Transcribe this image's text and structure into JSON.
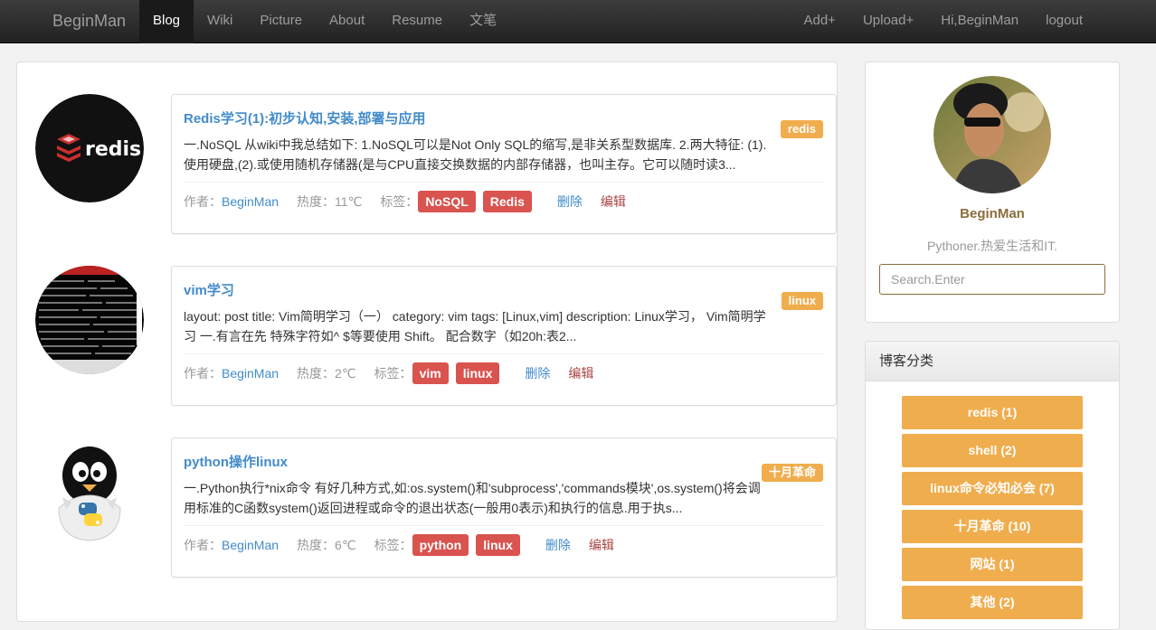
{
  "nav": {
    "brand": "BeginMan",
    "left": [
      "Blog",
      "Wiki",
      "Picture",
      "About",
      "Resume",
      "文笔"
    ],
    "right": [
      "Add+",
      "Upload+",
      "Hi,BeginMan",
      "logout"
    ]
  },
  "posts": [
    {
      "title": "Redis学习(1):初步认知,安装,部署与应用",
      "category": "redis",
      "excerpt": "一.NoSQL 从wiki中我总结如下: 1.NoSQL可以是Not Only SQL的缩写,是非关系型数据库. 2.两大特征: (1).使用硬盘,(2).或使用随机存储器(是与CPU直接交换数据的内部存储器，也叫主存。它可以随时读3...",
      "author_label": "作者：",
      "author": "BeginMan",
      "heat": "热度：11℃",
      "tags_label": "标签：",
      "tags": [
        "NoSQL",
        "Redis"
      ],
      "delete": "删除",
      "edit": "编辑",
      "thumb_text": "redis"
    },
    {
      "title": "vim学习",
      "category": "linux",
      "excerpt": "layout: post title: Vim简明学习（一） category: vim tags: [Linux,vim] description: Linux学习， Vim简明学习 一.有言在先 特殊字符如^ $等要使用 Shift。 配合数字（如20h:表2...",
      "author_label": "作者：",
      "author": "BeginMan",
      "heat": "热度：2℃",
      "tags_label": "标签：",
      "tags": [
        "vim",
        "linux"
      ],
      "delete": "删除",
      "edit": "编辑"
    },
    {
      "title": "python操作linux",
      "category": "十月革命",
      "excerpt": "一.Python执行*nix命令 有好几种方式,如:os.system()和'subprocess','commands模块',os.system()将会调用标准的C函数system()返回进程或命令的退出状态(一般用0表示)和执行的信息.用于执s...",
      "author_label": "作者：",
      "author": "BeginMan",
      "heat": "热度：6℃",
      "tags_label": "标签：",
      "tags": [
        "python",
        "linux"
      ],
      "delete": "删除",
      "edit": "编辑"
    }
  ],
  "profile": {
    "name": "BeginMan",
    "bio": "Pythoner.热爱生活和IT.",
    "search_placeholder": "Search.Enter"
  },
  "categories": {
    "title": "博客分类",
    "items": [
      "redis (1)",
      "shell (2)",
      "linux命令必知必会 (7)",
      "十月革命 (10)",
      "网站 (1)",
      "其他 (2)"
    ]
  },
  "colors": {
    "accent": "#f0ad4e",
    "tag": "#d9534f",
    "link": "#428bca"
  }
}
